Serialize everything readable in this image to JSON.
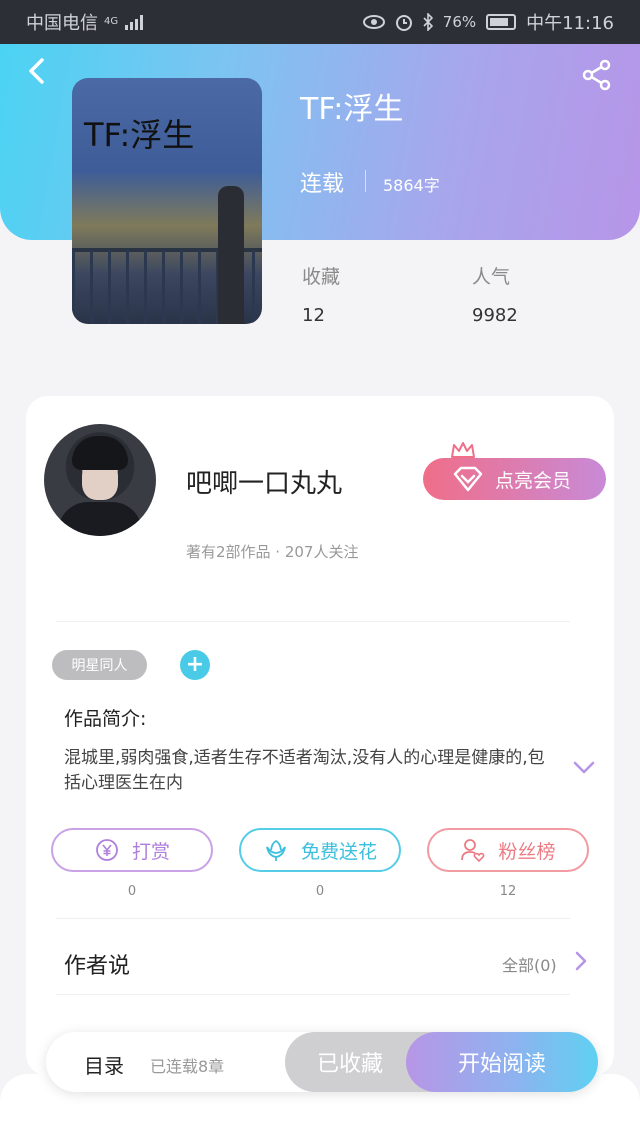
{
  "status_bar": {
    "carrier": "中国电信",
    "network": "4G",
    "battery": "76%",
    "time": "中午11:16"
  },
  "book": {
    "cover_title": "TF:浮生",
    "title": "TF:浮生",
    "status": "连载",
    "word_count": "5864字",
    "stats": [
      {
        "label": "收藏",
        "value": "12"
      },
      {
        "label": "人气",
        "value": "9982"
      }
    ]
  },
  "author": {
    "name": "吧唧一口丸丸",
    "meta": "著有2部作品 · 207人关注",
    "vip_label": "点亮会员"
  },
  "tags": [
    "明星同人"
  ],
  "intro": {
    "label": "作品简介:",
    "text": "混城里,弱肉强食,适者生存不适者淘汰,没有人的心理是健康的,包括心理医生在内"
  },
  "actions": [
    {
      "label": "打赏",
      "count": "0",
      "icon": "yen-icon"
    },
    {
      "label": "免费送花",
      "count": "0",
      "icon": "flower-icon"
    },
    {
      "label": "粉丝榜",
      "count": "12",
      "icon": "user-heart-icon"
    }
  ],
  "rows": [
    {
      "label": "作者说",
      "right": "全部(0)"
    }
  ],
  "bottom_bar": {
    "toc_label": "目录",
    "toc_sub": "已连载8章",
    "collected_label": "已收藏",
    "read_label": "开始阅读"
  },
  "colors": {
    "accent_cyan": "#4bd3f3",
    "accent_purple": "#b795e8",
    "vip_pink": "#f06e88"
  }
}
